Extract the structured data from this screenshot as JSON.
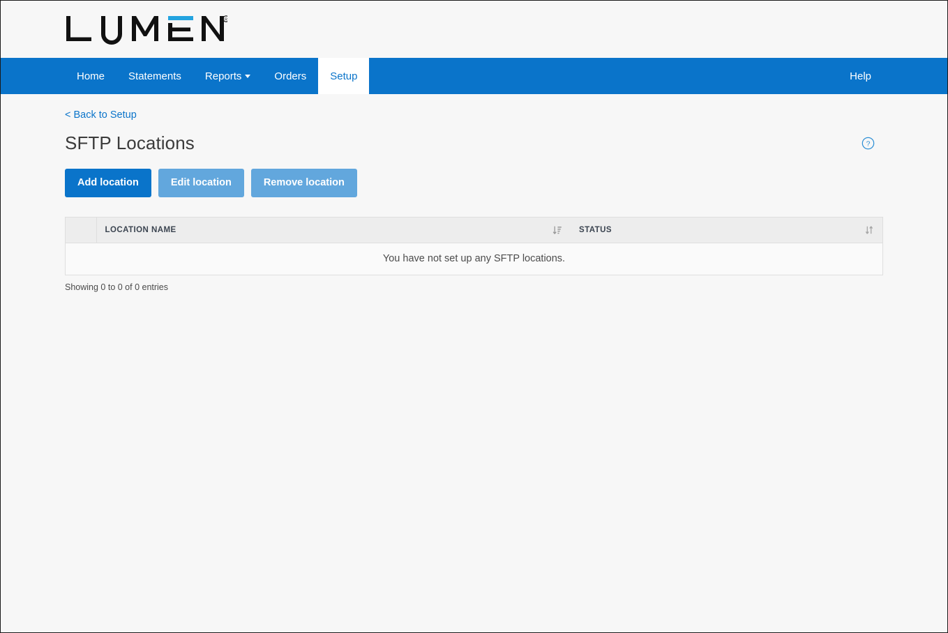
{
  "brand": {
    "logo_text": "LUMEN",
    "logo_registered_mark": "®",
    "logo_accent_color": "#24a4e0",
    "logo_color": "#111111"
  },
  "navbar": {
    "background_color": "#0a74ca",
    "items": [
      {
        "label": "Home",
        "active": false,
        "has_caret": false
      },
      {
        "label": "Statements",
        "active": false,
        "has_caret": false
      },
      {
        "label": "Reports",
        "active": false,
        "has_caret": true
      },
      {
        "label": "Orders",
        "active": false,
        "has_caret": false
      },
      {
        "label": "Setup",
        "active": true,
        "has_caret": false
      }
    ],
    "help_label": "Help"
  },
  "breadcrumb": {
    "label": "< Back to Setup"
  },
  "page": {
    "title": "SFTP Locations",
    "help_icon_label": "?"
  },
  "actions": {
    "add_label": "Add location",
    "edit_label": "Edit location",
    "remove_label": "Remove location",
    "primary_color": "#0a74ca",
    "muted_color": "#62a7dd"
  },
  "table": {
    "columns": [
      {
        "label": "",
        "sort": "none"
      },
      {
        "label": "LOCATION NAME",
        "sort": "desc"
      },
      {
        "label": "STATUS",
        "sort": "none"
      }
    ],
    "empty_message": "You have not set up any SFTP locations.",
    "rows": [],
    "footer": "Showing 0 to 0 of 0 entries"
  }
}
